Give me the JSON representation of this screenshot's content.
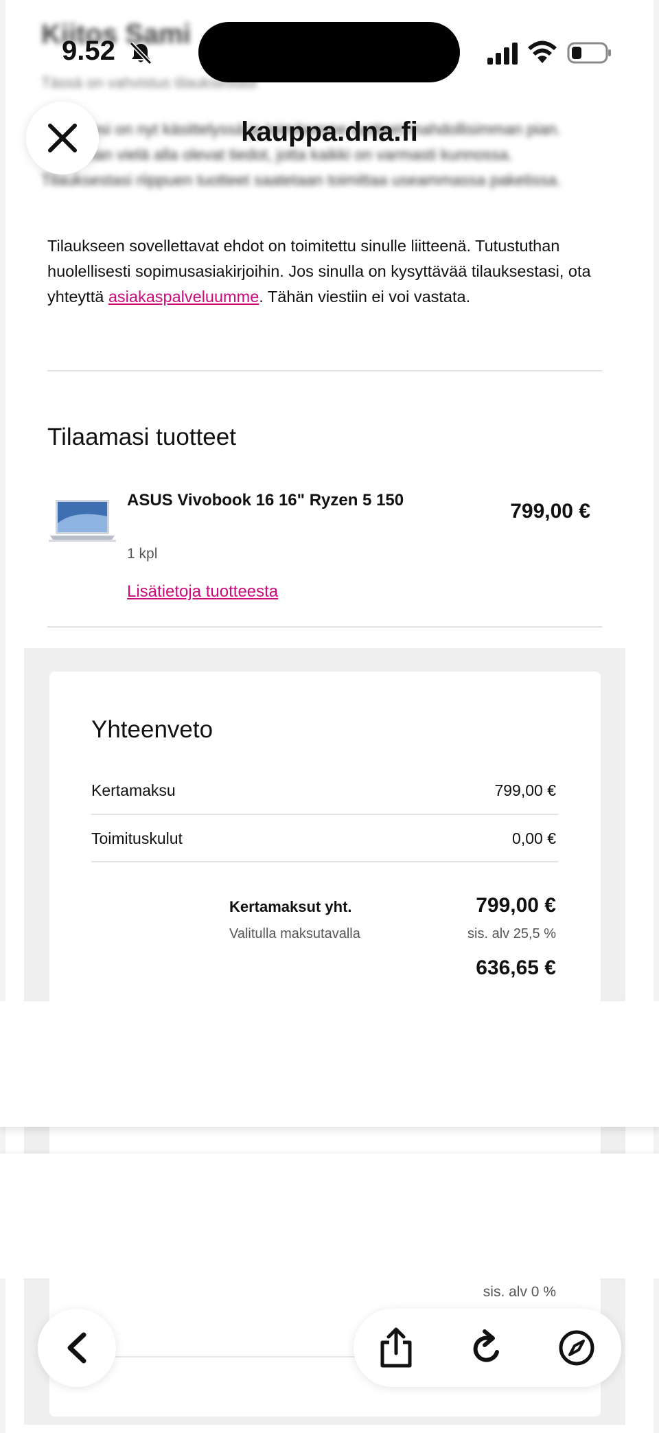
{
  "status_bar": {
    "time": "9.52"
  },
  "header": {
    "url": "kauppa.dna.fi"
  },
  "email": {
    "blurred_heading": "Kiitos Sami",
    "blurred_subheading": "Tässä on vahvistus tilauksestasi",
    "blurred_paragraph": "Tilauksesi on nyt käsittelyssä ja toimitamme tuotteet mahdollisimman pian. Katsothan vielä alla olevat tiedot, jotta kaikki on varmasti kunnossa. Tilauksestasi riippuen tuotteet saatetaan toimittaa useammassa paketissa.",
    "terms_text_before": "Tilaukseen sovellettavat ehdot on toimitettu sinulle liitteenä. Tutustuthan huolellisesti sopimusasiakirjoihin. Jos sinulla on kysyttävää tilauksestasi, ota yhteyttä ",
    "terms_link": "asiakaspalveluumme",
    "terms_text_after": ". Tähän viestiin ei voi vastata."
  },
  "products": {
    "title": "Tilaamasi tuotteet",
    "item": {
      "name": "ASUS Vivobook 16 16\" Ryzen 5 150",
      "quantity": "1 kpl",
      "price": "799,00 €",
      "details_link": "Lisätietoja tuotteesta"
    }
  },
  "summary": {
    "title": "Yhteenveto",
    "rows": [
      {
        "label": "Kertamaksu",
        "value": "799,00 €"
      },
      {
        "label": "Toimituskulut",
        "value": "0,00 €"
      }
    ],
    "total_label": "Kertamaksut yht.",
    "total_sub": "Valitulla maksutavalla",
    "total_value": "799,00 €",
    "total_vat": "sis. alv 25,5 %",
    "net_value": "636,65 €",
    "bottom_vat": "sis. alv 0 %"
  },
  "colors": {
    "link": "#cc0a7c",
    "summary_bg": "#efefef"
  }
}
